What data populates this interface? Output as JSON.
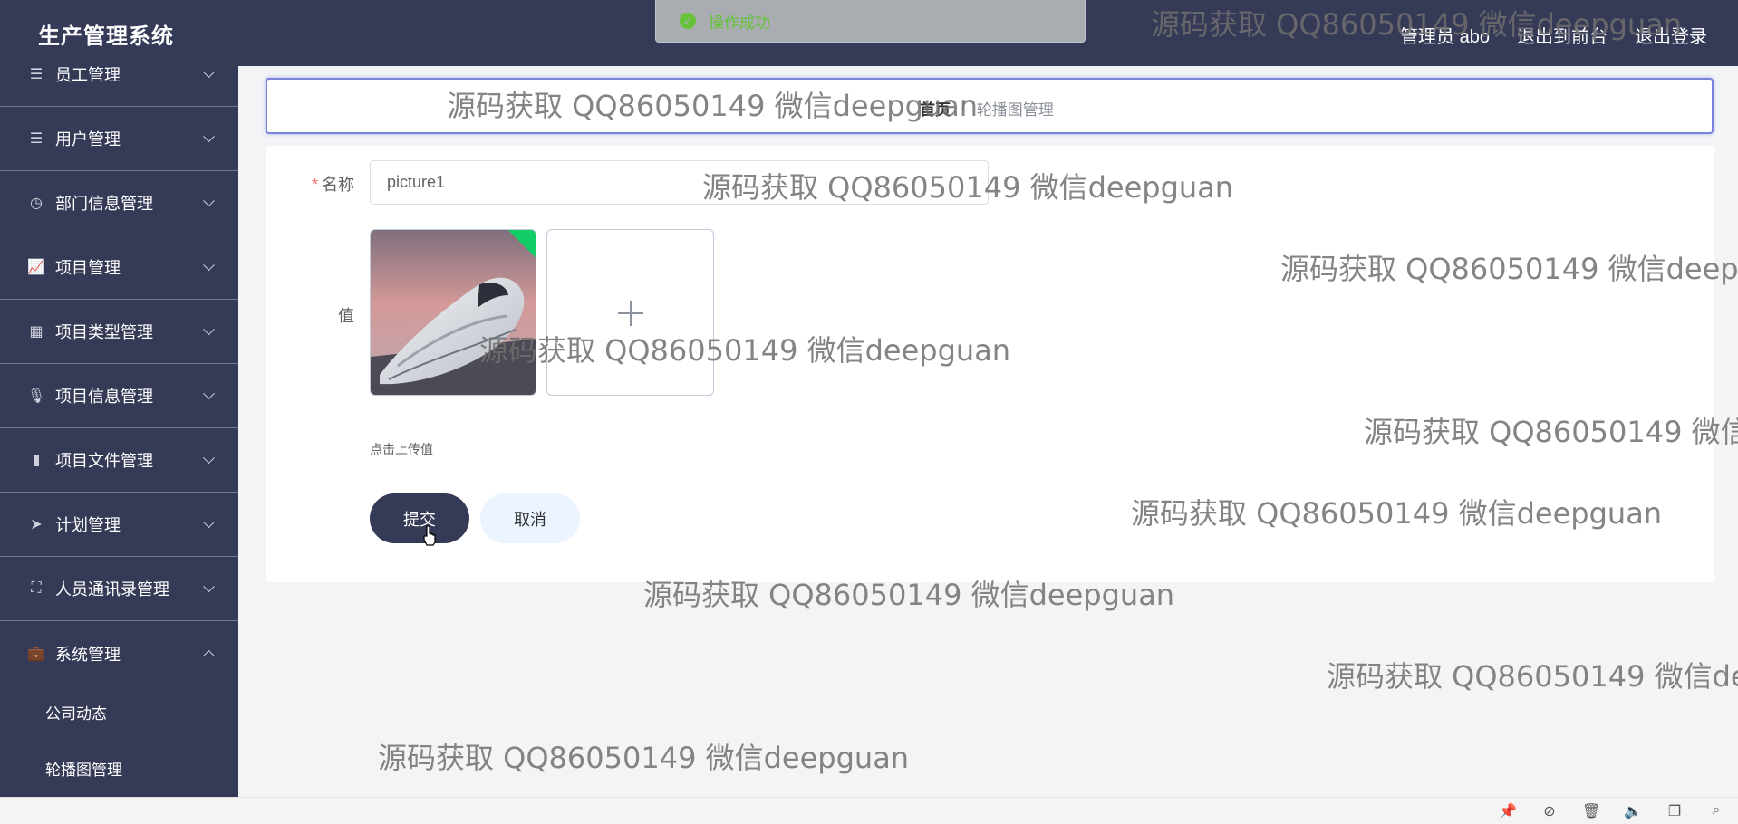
{
  "header": {
    "title": "生产管理系统",
    "user": "管理员 abo",
    "to_front": "退出到前台",
    "logout": "退出登录"
  },
  "toast": {
    "message": "操作成功",
    "color": "#67c23a"
  },
  "sidebar": {
    "items": [
      {
        "label": "员工管理",
        "icon": "list-icon"
      },
      {
        "label": "用户管理",
        "icon": "list-icon"
      },
      {
        "label": "部门信息管理",
        "icon": "clock-icon"
      },
      {
        "label": "项目管理",
        "icon": "line-chart-icon"
      },
      {
        "label": "项目类型管理",
        "icon": "grid-icon"
      },
      {
        "label": "项目信息管理",
        "icon": "microphone-icon"
      },
      {
        "label": "项目文件管理",
        "icon": "bar-chart-icon"
      },
      {
        "label": "计划管理",
        "icon": "paper-plane-icon"
      },
      {
        "label": "人员通讯录管理",
        "icon": "full-screen-icon"
      },
      {
        "label": "系统管理",
        "icon": "briefcase-icon"
      }
    ],
    "subitems": [
      "公司动态",
      "轮播图管理"
    ]
  },
  "breadcrumb": {
    "home": "首页",
    "separator": "/",
    "current": "轮播图管理"
  },
  "form": {
    "name_label": "名称",
    "name_value": "picture1",
    "value_label": "值",
    "upload_tip": "点击上传值",
    "submit": "提交",
    "cancel": "取消"
  },
  "watermark": "源码获取 QQ86050149 微信deepguan",
  "colors": {
    "header_bg": "#353a57",
    "sidebar_bg": "#353a57",
    "success": "#13ce66",
    "cancel_bg": "#ecf5ff"
  }
}
